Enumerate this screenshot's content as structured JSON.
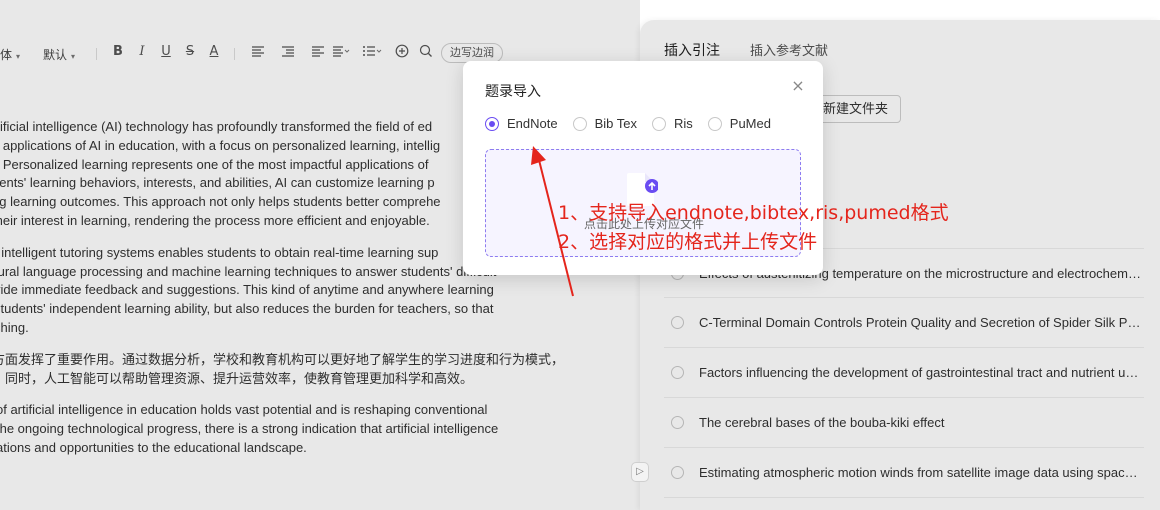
{
  "toolbar": {
    "font_family": "体",
    "font_size": "默认",
    "wrap_button": "边写边润",
    "icons": [
      "bold-icon",
      "italic-icon",
      "underline-icon",
      "strikethrough-icon",
      "font-color-icon",
      "align-icon",
      "indent-icon",
      "text-align-icon",
      "list-icon",
      "add-icon",
      "search-icon"
    ]
  },
  "document": {
    "paragraphs": [
      {
        "lines": [
          "rtificial intelligence (AI) technology has profoundly transformed the field of ed",
          "e applications of AI in education, with a focus on personalized learning, intellig",
          "t. Personalized learning represents one of the most impactful applications of",
          "dents' learning behaviors, interests, and abilities, AI can customize learning p",
          "ng learning outcomes. This approach not only helps students better comprehe",
          " their interest in learning, rendering the process more efficient and enjoyable."
        ]
      },
      {
        "lines": [
          "f intelligent tutoring systems enables students to obtain real-time learning sup",
          "tural language processing and machine learning techniques to answer students' difficult",
          "vide immediate feedback and suggestions. This kind of anytime and anywhere learning",
          "students' independent learning ability, but also reduces the burden for teachers, so that",
          "ching."
        ]
      },
      {
        "lines": [
          "方面发挥了重要作用。通过数据分析，学校和教育机构可以更好地了解学生的学习进度和行为模式，",
          "。同时，人工智能可以帮助管理资源、提升运营效率，使教育管理更加科学和高效。"
        ]
      },
      {
        "lines": [
          "of artificial intelligence in education holds vast potential and is reshaping conventional",
          "the ongoing technological progress, there is a strong indication that artificial intelligence",
          "ations and opportunities to the educational landscape."
        ]
      }
    ]
  },
  "panel": {
    "tabs": [
      "插入引注",
      "插入参考文献"
    ],
    "new_folder": "新建文件夹",
    "references": [
      "Effects of austenitizing temperature on the microstructure and electrochemical behavior of a martensitic stainless steel",
      "C-Terminal Domain Controls Protein Quality and Secretion of Spider Silk Proteins",
      "Factors influencing the development of gastrointestinal tract and nutrient utilization in broiler chickens",
      "The cerebral bases of the bouba-kiki effect",
      "Estimating atmospheric motion winds from satellite image data using space-time drift models"
    ]
  },
  "modal": {
    "title": "题录导入",
    "close": "×",
    "formats": [
      {
        "label": "EndNote",
        "checked": true
      },
      {
        "label": "Bib Tex",
        "checked": false
      },
      {
        "label": "Ris",
        "checked": false
      },
      {
        "label": "PuMed",
        "checked": false
      }
    ],
    "upload_text": "点击此处上传对应文件",
    "upload_icon": "file-upload-icon",
    "accent_color": "#6a4cf2"
  },
  "annotations": {
    "line1": "1、支持导入endnote,bibtex,ris,pumed格式",
    "line2": "2、选择对应的格式并上传文件",
    "color": "#e4251c"
  }
}
